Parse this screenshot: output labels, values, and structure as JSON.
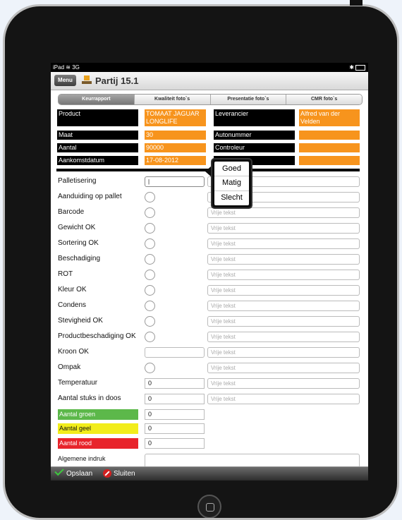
{
  "status": {
    "carrier": "iPad",
    "network": "3G",
    "bluetooth": "✱"
  },
  "nav": {
    "menu": "Menu",
    "title": "Partij 15.1"
  },
  "tabs": [
    "Keurrapport",
    "Kwaliteit foto`s",
    "Presentatie foto`s",
    "CMR foto`s"
  ],
  "header_fields": {
    "product_label": "Product",
    "product_value": "TOMAAT JAGUAR LONGLIFE",
    "leverancier_label": "Leverancier",
    "leverancier_value": "Alfred van der Velden",
    "maat_label": "Maat",
    "maat_value": "30",
    "autonummer_label": "Autonummer",
    "autonummer_value": "",
    "aantal_label": "Aantal",
    "aantal_value": "90000",
    "controleur_label": "Controleur",
    "controleur_value": "",
    "aankomst_label": "Aankomstdatum",
    "aankomst_value": "17-08-2012"
  },
  "rows": [
    {
      "label": "Palletisering",
      "text": ""
    },
    {
      "label": "Aanduiding op pallet",
      "text": ""
    },
    {
      "label": "Barcode",
      "text": "Vrije tekst"
    },
    {
      "label": "Gewicht OK",
      "text": "Vrije tekst"
    },
    {
      "label": "Sortering OK",
      "text": "Vrije tekst"
    },
    {
      "label": "Beschadiging",
      "text": "Vrije tekst"
    },
    {
      "label": "ROT",
      "text": "Vrije tekst"
    },
    {
      "label": "Kleur OK",
      "text": "Vrije tekst"
    },
    {
      "label": "Condens",
      "text": "Vrije tekst"
    },
    {
      "label": "Stevigheid OK",
      "text": "Vrije tekst"
    },
    {
      "label": "Productbeschadiging OK",
      "text": "Vrije tekst"
    },
    {
      "label": "Kroon OK",
      "text": "Vrije tekst"
    },
    {
      "label": "Ompak",
      "text": "Vrije tekst"
    },
    {
      "label": "Temperatuur",
      "value": "0",
      "text": "Vrije tekst"
    },
    {
      "label": "Aantal stuks in doos",
      "value": "0",
      "text": "Vrije tekst"
    }
  ],
  "counts": [
    {
      "label": "Aantal groen",
      "value": "0",
      "color": "#5cb84a"
    },
    {
      "label": "Aantal geel",
      "value": "0",
      "color": "#f2ed1c"
    },
    {
      "label": "Aantal rood",
      "value": "0",
      "color": "#e8242b"
    }
  ],
  "algemeen_label": "Algemene indruk",
  "popover": {
    "options": [
      "Goed",
      "Matig",
      "Slecht"
    ]
  },
  "bottom": {
    "save": "Opslaan",
    "close": "Sluiten"
  },
  "colors": {
    "orange": "#f7941d",
    "dark": "#000000"
  }
}
